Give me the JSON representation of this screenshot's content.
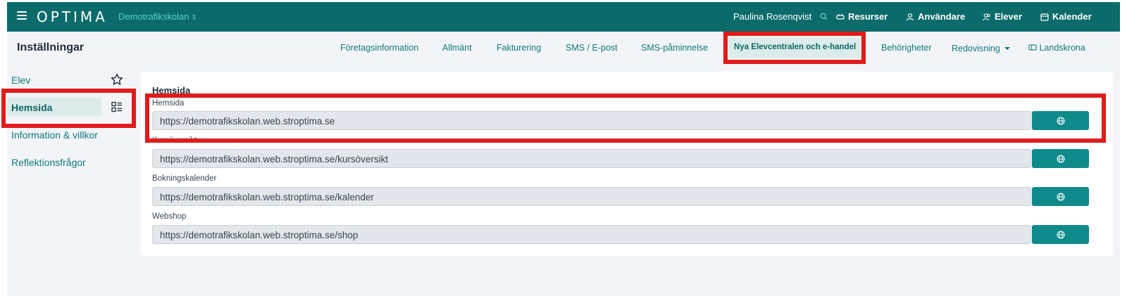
{
  "topbar": {
    "logo": "OPTIMA",
    "school": "Demotrafikskolan",
    "user": "Paulina Rosenqvist",
    "nav": [
      {
        "label": "Resurser",
        "icon": "car-icon"
      },
      {
        "label": "Användare",
        "icon": "user-icon"
      },
      {
        "label": "Elever",
        "icon": "users-icon"
      },
      {
        "label": "Kalender",
        "icon": "calendar-icon"
      }
    ]
  },
  "settings": {
    "title": "Inställningar",
    "tabs": [
      {
        "label": "Företagsinformation"
      },
      {
        "label": "Allmänt"
      },
      {
        "label": "Fakturering"
      },
      {
        "label": "SMS / E-post"
      },
      {
        "label": "SMS-påminnelse"
      },
      {
        "label": "Nya Elevcentralen och e-handel",
        "active": true
      },
      {
        "label": "Behörigheter"
      },
      {
        "label": "Redovisning"
      },
      {
        "label": "Landskrona"
      }
    ]
  },
  "sidebar": {
    "items": [
      {
        "label": "Elev"
      },
      {
        "label": "Hemsida",
        "active": true
      },
      {
        "label": "Information & villkor"
      },
      {
        "label": "Reflektionsfrågor"
      }
    ]
  },
  "content": {
    "title": "Hemsida",
    "fields": [
      {
        "label": "Hemsida",
        "value": "https://demotrafikskolan.web.stroptima.se"
      },
      {
        "label": "Kursöversikt",
        "value": "https://demotrafikskolan.web.stroptima.se/kursöversikt"
      },
      {
        "label": "Bokningskalender",
        "value": "https://demotrafikskolan.web.stroptima.se/kalender"
      },
      {
        "label": "Webshop",
        "value": "https://demotrafikskolan.web.stroptima.se/shop"
      }
    ]
  },
  "colors": {
    "primary": "#0b6b6b",
    "accent": "#0e8a8a",
    "highlight": "#e01b1b"
  }
}
